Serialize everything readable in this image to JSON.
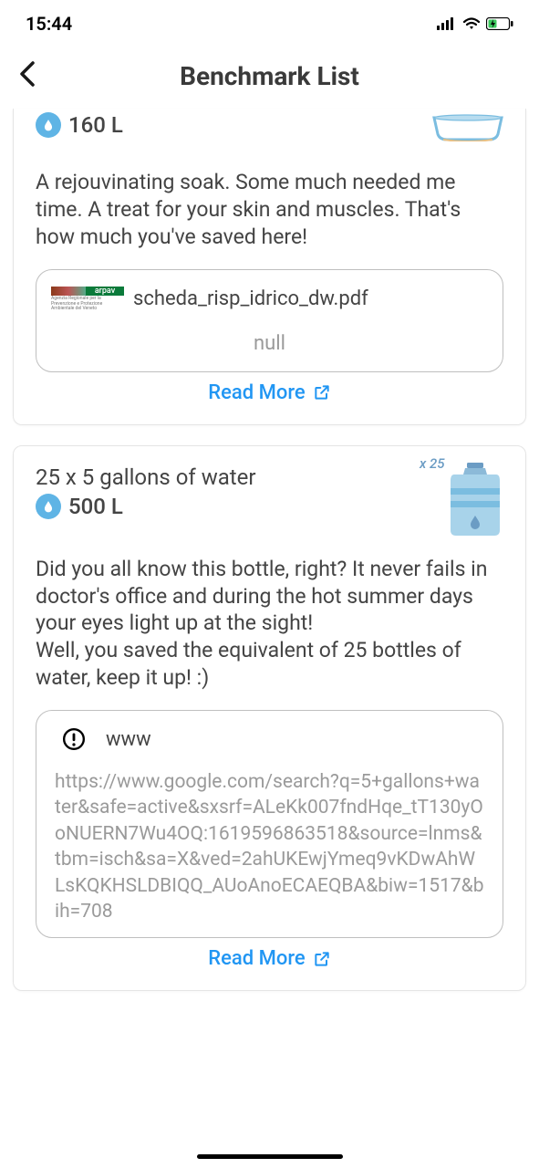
{
  "status_bar": {
    "time": "15:44"
  },
  "header": {
    "title": "Benchmark List"
  },
  "cards": [
    {
      "liters": "160 L",
      "description": "A rejouvinating soak. Some much needed me time. A treat for your skin and muscles. That's how much you've saved here!",
      "link_badge": "arpav",
      "link_filename": "scheda_risp_idrico_dw.pdf",
      "link_sub": "null",
      "read_more": "Read More"
    },
    {
      "title": "25 x 5 gallons of water",
      "liters": "500 L",
      "count_label": "x 25",
      "description": "Did you all know this bottle, right? It never fails in doctor's office and during the hot summer days your eyes light up at the sight!\nWell, you saved the equivalent of 25 bottles of water, keep it up! :)",
      "link_label": "www",
      "link_url": "https://www.google.com/search?q=5+gallons+water&safe=active&sxsrf=ALeKk007fndHqe_tT130yOoNUERN7Wu4OQ:1619596863518&source=lnms&tbm=isch&sa=X&ved=2ahUKEwjYmeq9vKDwAhWLsKQKHSLDBIQQ_AUoAnoECAEQBA&biw=1517&bih=708",
      "read_more": "Read More"
    }
  ]
}
